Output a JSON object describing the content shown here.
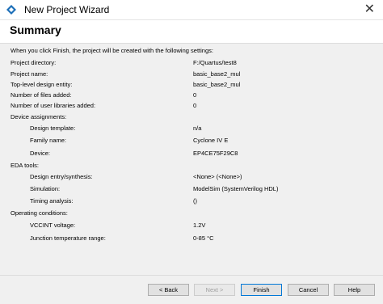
{
  "window": {
    "title": "New Project Wizard",
    "close_glyph": "✕"
  },
  "page": {
    "heading": "Summary",
    "intro": "When you click Finish, the project will be created with the following settings:"
  },
  "settings": {
    "project_directory": {
      "label": "Project directory:",
      "value": "F:/Quartus/test8"
    },
    "project_name": {
      "label": "Project name:",
      "value": "basic_base2_mul"
    },
    "top_level": {
      "label": "Top-level design entity:",
      "value": "basic_base2_mul"
    },
    "files_added": {
      "label": "Number of files added:",
      "value": "0"
    },
    "libraries_added": {
      "label": "Number of user libraries added:",
      "value": "0"
    },
    "device_assignments": {
      "label": "Device assignments:"
    },
    "design_template": {
      "label": "Design template:",
      "value": "n/a"
    },
    "family_name": {
      "label": "Family name:",
      "value": "Cyclone IV E"
    },
    "device": {
      "label": "Device:",
      "value": "EP4CE75F29C8"
    },
    "eda_tools": {
      "label": "EDA tools:"
    },
    "design_entry": {
      "label": "Design entry/synthesis:",
      "value": "<None> (<None>)"
    },
    "simulation": {
      "label": "Simulation:",
      "value": "ModelSim (SystemVerilog HDL)"
    },
    "timing_analysis": {
      "label": "Timing analysis:",
      "value": "()"
    },
    "operating_conditions": {
      "label": "Operating conditions:"
    },
    "vccint": {
      "label": "VCCINT voltage:",
      "value": "1.2V"
    },
    "junction_temp": {
      "label": "Junction temperature range:",
      "value": "0-85 °C"
    }
  },
  "buttons": {
    "back": "< Back",
    "next": "Next >",
    "finish": "Finish",
    "cancel": "Cancel",
    "help": "Help"
  },
  "colors": {
    "accent": "#0078d7",
    "panel": "#f0f0f0"
  }
}
